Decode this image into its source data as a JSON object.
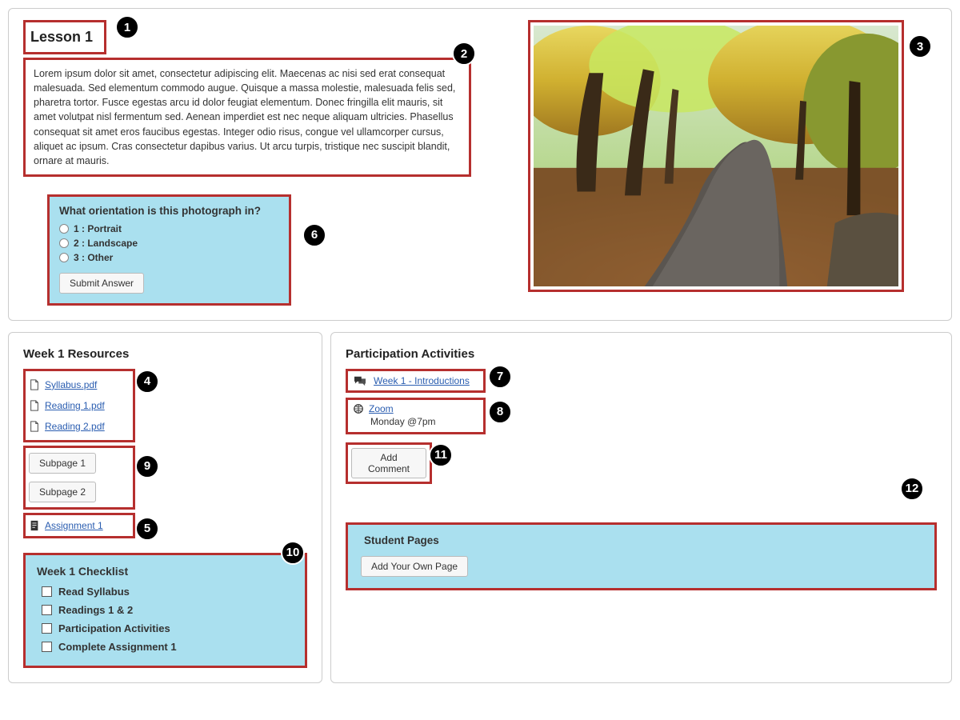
{
  "lesson": {
    "title": "Lesson 1",
    "body": "Lorem ipsum dolor sit amet, consectetur adipiscing elit. Maecenas ac nisi sed erat consequat malesuada. Sed elementum commodo augue. Quisque a massa molestie, malesuada felis sed, pharetra tortor. Fusce egestas arcu id dolor feugiat elementum. Donec fringilla elit mauris, sit amet volutpat nisl fermentum sed. Aenean imperdiet est nec neque aliquam ultricies. Phasellus consequat sit amet eros faucibus egestas. Integer odio risus, congue vel ullamcorper cursus, aliquet ac ipsum. Cras consectetur dapibus varius. Ut arcu turpis, tristique nec suscipit blandit, ornare at mauris."
  },
  "quiz": {
    "question": "What orientation is this photograph in?",
    "options": [
      "1 : Portrait",
      "2 : Landscape",
      "3 : Other"
    ],
    "submit": "Submit Answer"
  },
  "resources": {
    "heading": "Week 1 Resources",
    "files": [
      "Syllabus.pdf",
      "Reading 1.pdf",
      "Reading 2.pdf"
    ],
    "subpages": [
      "Subpage 1",
      "Subpage 2"
    ],
    "assignment": "Assignment 1"
  },
  "checklist": {
    "heading": "Week 1 Checklist",
    "items": [
      "Read Syllabus",
      "Readings 1 & 2",
      "Participation Activities",
      "Complete Assignment 1"
    ]
  },
  "participation": {
    "heading": "Participation Activities",
    "discussion": "Week 1 - Introductions",
    "zoom_label": "Zoom",
    "zoom_time": "Monday @7pm",
    "add_comment": "Add Comment"
  },
  "student_pages": {
    "heading": "Student Pages",
    "add_btn": "Add Your Own Page"
  },
  "callouts": {
    "c1": "1",
    "c2": "2",
    "c3": "3",
    "c4": "4",
    "c5": "5",
    "c6": "6",
    "c7": "7",
    "c8": "8",
    "c9": "9",
    "c10": "10",
    "c11": "11",
    "c12": "12"
  }
}
